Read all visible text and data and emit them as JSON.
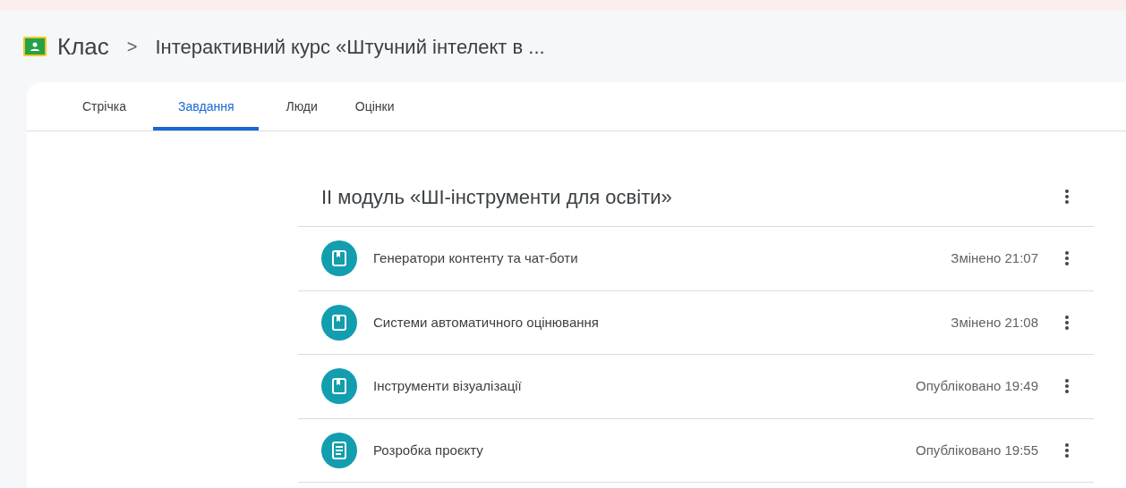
{
  "breadcrumb": {
    "app": "Клас",
    "separator": ">",
    "course": "Інтерактивний курс «Штучний інтелект в ..."
  },
  "tabs": [
    {
      "label": "Стрічка",
      "selected": false
    },
    {
      "label": "Завдання",
      "selected": true
    },
    {
      "label": "Люди",
      "selected": false
    },
    {
      "label": "Оцінки",
      "selected": false
    }
  ],
  "topic": {
    "title": "ІІ модуль «ШІ-інструменти для освіти»"
  },
  "items": [
    {
      "kind": "material",
      "title": "Генератори контенту та чат-боти",
      "status": "Змінено 21:07"
    },
    {
      "kind": "material",
      "title": "Системи автоматичного оцінювання",
      "status": "Змінено 21:08"
    },
    {
      "kind": "material",
      "title": "Інструменти візуалізації",
      "status": "Опубліковано 19:49"
    },
    {
      "kind": "assignment",
      "title": "Розробка проєкту",
      "status": "Опубліковано 19:55"
    }
  ]
}
